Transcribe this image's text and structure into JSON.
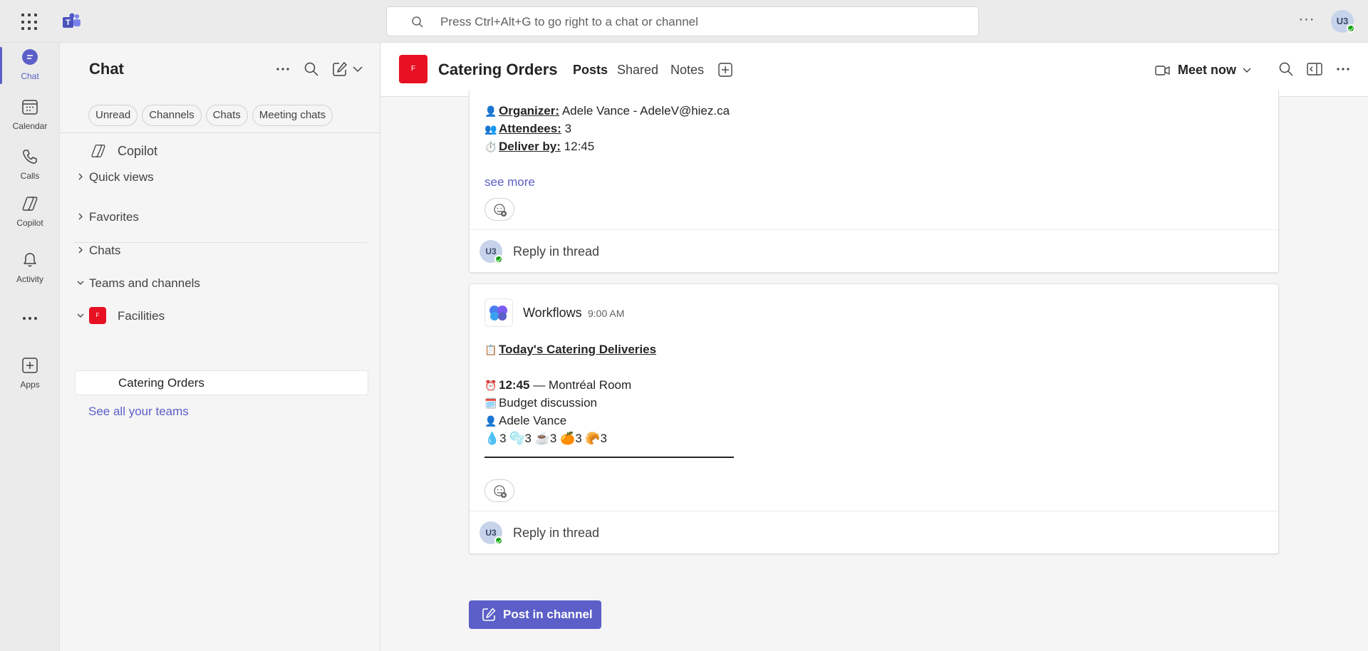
{
  "topbar": {
    "search_placeholder": "Press Ctrl+Alt+G to go right to a chat or channel",
    "more_label": "···",
    "avatar_initials": "U3"
  },
  "rail": {
    "items": [
      {
        "label": "Chat",
        "icon": "chat-icon"
      },
      {
        "label": "Calendar",
        "icon": "calendar-icon"
      },
      {
        "label": "Calls",
        "icon": "calls-icon"
      },
      {
        "label": "Copilot",
        "icon": "copilot-icon"
      },
      {
        "label": "Activity",
        "icon": "bell-icon"
      },
      {
        "label": "Apps",
        "icon": "apps-icon"
      }
    ]
  },
  "panel": {
    "title": "Chat",
    "filters": [
      "Unread",
      "Channels",
      "Chats",
      "Meeting chats"
    ],
    "copilot": "Copilot",
    "quick_views": "Quick views",
    "favorites": "Favorites",
    "chats": "Chats",
    "teams_and_channels": "Teams and channels",
    "team_name": "Facilities",
    "team_initial": "F",
    "channel_name": "Catering Orders",
    "see_all": "See all your teams"
  },
  "header": {
    "channel_initial": "F",
    "channel_name": "Catering Orders",
    "tabs": [
      "Posts",
      "Shared",
      "Notes"
    ],
    "meet_now": "Meet now"
  },
  "card1": {
    "organizer_label": "Organizer:",
    "organizer_value": " Adele Vance - AdeleV@hiez.ca",
    "attendees_label": "Attendees:",
    "attendees_value": " 3",
    "deliver_label": "Deliver by:",
    "deliver_value": " 12:45",
    "see_more": "see more",
    "reply": "Reply in thread",
    "reply_initials": "U3"
  },
  "card2": {
    "sender": "Workflows",
    "time": "9:00 AM",
    "title": "Today's Catering Deliveries",
    "time_slot": "12:45",
    "room": " — Montréal Room",
    "meeting": "Budget discussion",
    "organizer": "Adele Vance",
    "counts": "💧3  🫧3  ☕3  🍊3  🥐3",
    "reply": "Reply in thread",
    "reply_initials": "U3"
  },
  "footer": {
    "post_button": "Post in channel"
  },
  "colors": {
    "accent": "#5b5fc7",
    "team_red": "#e81123",
    "presence": "#13a10e"
  }
}
